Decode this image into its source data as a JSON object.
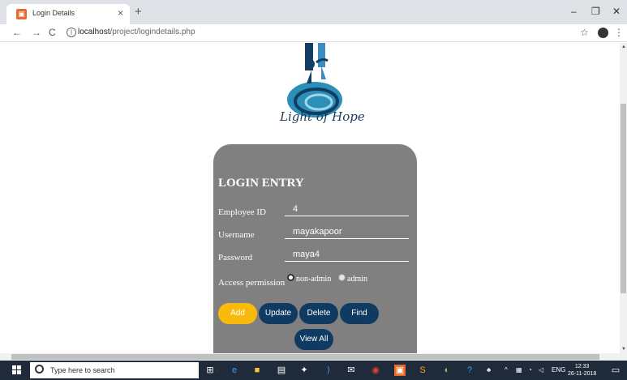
{
  "browser": {
    "tab_title": "Login Details",
    "tab_close": "×",
    "new_tab": "+",
    "minimize": "–",
    "maximize": "❐",
    "close": "✕",
    "address_host": "localhost",
    "address_path": "/project/logindetails.php",
    "back": "←",
    "forward": "→",
    "reload": "C",
    "bookmark": "☆",
    "menu": "⋮"
  },
  "logo": {
    "text": "Light of Hope"
  },
  "form": {
    "title": "LOGIN ENTRY",
    "fields": [
      {
        "label": "Employee ID",
        "value": "4"
      },
      {
        "label": "Username",
        "value": "mayakapoor"
      },
      {
        "label": "Password",
        "value": "maya4"
      }
    ],
    "permission_label": "Access permission",
    "options": [
      {
        "label": "non-admin",
        "selected": true
      },
      {
        "label": "admin",
        "selected": false
      }
    ],
    "buttons": {
      "add": "Add",
      "update": "Update",
      "delete": "Delete",
      "find": "Find",
      "view_all": "View All"
    }
  },
  "taskbar": {
    "search_placeholder": "Type here to search",
    "language": "ENG",
    "time": "12:33",
    "date": "26-11-2018"
  },
  "colors": {
    "card": "#808080",
    "add_button": "#f9bb0b",
    "dark_button": "#0f3a62",
    "taskbar": "#1f2b3a"
  }
}
